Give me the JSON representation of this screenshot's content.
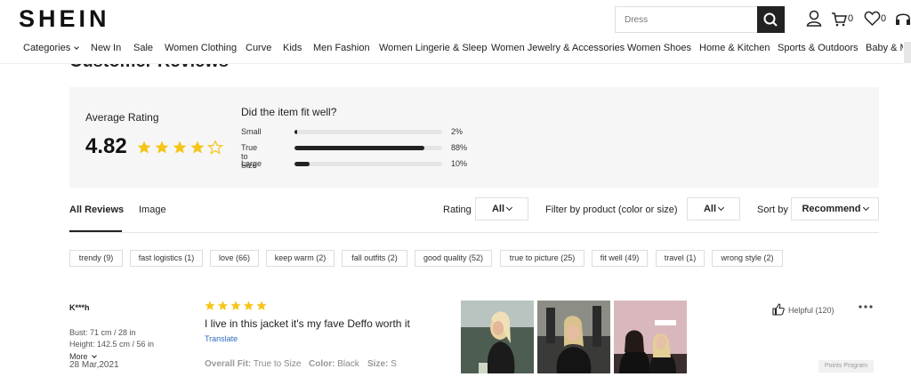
{
  "header": {
    "logo": "SHEIN",
    "search_placeholder": "Dress",
    "cart_count": "0",
    "wishlist_count": "0"
  },
  "nav": {
    "items": [
      {
        "label": "Categories"
      },
      {
        "label": "New In"
      },
      {
        "label": "Sale"
      },
      {
        "label": "Women Clothing"
      },
      {
        "label": "Curve"
      },
      {
        "label": "Kids"
      },
      {
        "label": "Men Fashion"
      },
      {
        "label": "Women Lingerie & Sleep"
      },
      {
        "label": "Women Jewelry & Accessories"
      },
      {
        "label": "Women Shoes"
      },
      {
        "label": "Home & Kitchen"
      },
      {
        "label": "Sports & Outdoors"
      },
      {
        "label": "Baby & M"
      }
    ]
  },
  "reviews": {
    "section_title": "Customer Reviews",
    "average_label": "Average Rating",
    "average_value": "4.82",
    "average_stars": 4.5,
    "fit_title": "Did the item fit well?",
    "fit": [
      {
        "label": "Small",
        "percent_label": "2%",
        "percent": 2
      },
      {
        "label": "True to Size",
        "percent_label": "88%",
        "percent": 88
      },
      {
        "label": "Large",
        "percent_label": "10%",
        "percent": 10
      }
    ],
    "tabs": [
      {
        "label": "All Reviews"
      },
      {
        "label": "Image"
      }
    ],
    "filters": {
      "rating_label": "Rating",
      "rating_value": "All",
      "product_label": "Filter by product  (color or size)",
      "product_value": "All",
      "sort_label": "Sort by",
      "sort_value": "Recommend"
    },
    "tags": [
      "trendy (9)",
      "fast logistics (1)",
      "love (66)",
      "keep warm (2)",
      "fall outfits (2)",
      "good quality (52)",
      "true to picture (25)",
      "fit well (49)",
      "travel (1)",
      "wrong style (2)"
    ],
    "review": {
      "user": "K***h",
      "bust": "Bust: 71 cm / 28 in",
      "height": "Height: 142.5 cm / 56 in",
      "more": "More",
      "date": "28 Mar,2021",
      "stars": 5,
      "text": "I live in this jacket it's my fave Deffo worth it",
      "translate": "Translate",
      "overall_fit_label": "Overall Fit:",
      "overall_fit_value": "True to Size",
      "color_label": "Color:",
      "color_value": "Black",
      "size_label": "Size:",
      "size_value": "S",
      "helpful": "Helpful (120)"
    },
    "points_program": "Points Program"
  },
  "colors": {
    "star": "#f5c518",
    "dark": "#222222",
    "link": "#2e6bc6"
  }
}
